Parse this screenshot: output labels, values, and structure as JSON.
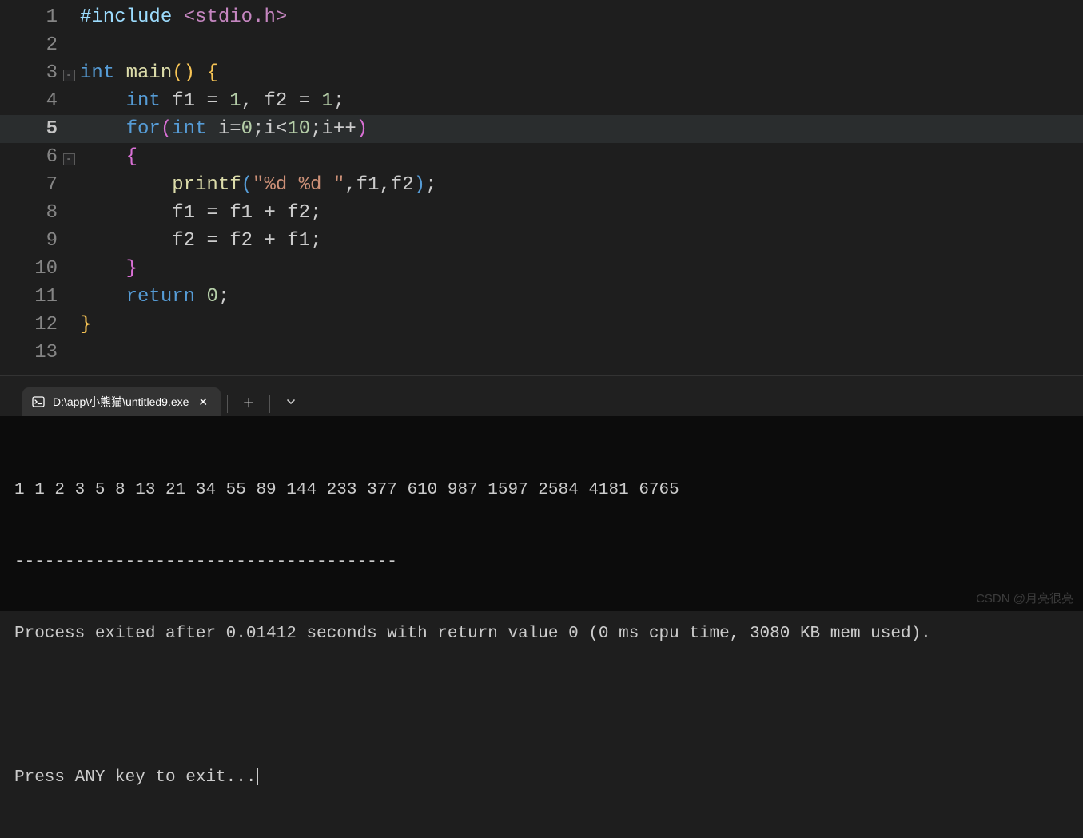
{
  "editor": {
    "highlighted_line": 5,
    "lines": [
      {
        "n": 1,
        "fold": "",
        "html": "<span class='pp'>#include</span> <span class='hdr'>&lt;stdio.h&gt;</span>"
      },
      {
        "n": 2,
        "fold": "line",
        "html": ""
      },
      {
        "n": 3,
        "fold": "box",
        "html": "<span class='kw'>int</span> <span class='fn'>main</span><span class='brace'>(</span><span class='brace'>)</span> <span class='brace'>{</span>"
      },
      {
        "n": 4,
        "fold": "line",
        "html": "    <span class='kw'>int</span> <span class='var'>f1</span> <span class='op'>=</span> <span class='num'>1</span><span class='punc'>,</span> <span class='var'>f2</span> <span class='op'>=</span> <span class='num'>1</span><span class='punc'>;</span>"
      },
      {
        "n": 5,
        "fold": "line",
        "html": "    <span class='kw'>for</span><span class='br2'>(</span><span class='kw'>int</span> <span class='var'>i</span><span class='op'>=</span><span class='num'>0</span><span class='punc'>;</span><span class='var'>i</span><span class='op'>&lt;</span><span class='num'>10</span><span class='punc'>;</span><span class='var'>i</span><span class='op'>++</span><span class='br2'>)</span>"
      },
      {
        "n": 6,
        "fold": "box",
        "html": "    <span class='br2'>{</span>"
      },
      {
        "n": 7,
        "fold": "line",
        "html": "        <span class='fn'>printf</span><span class='br3'>(</span><span class='str'>\"%d %d \"</span><span class='punc'>,</span><span class='var'>f1</span><span class='punc'>,</span><span class='var'>f2</span><span class='br3'>)</span><span class='punc'>;</span>"
      },
      {
        "n": 8,
        "fold": "line",
        "html": "        <span class='var'>f1</span> <span class='op'>=</span> <span class='var'>f1</span> <span class='op'>+</span> <span class='var'>f2</span><span class='punc'>;</span>"
      },
      {
        "n": 9,
        "fold": "line",
        "html": "        <span class='var'>f2</span> <span class='op'>=</span> <span class='var'>f2</span> <span class='op'>+</span> <span class='var'>f1</span><span class='punc'>;</span>"
      },
      {
        "n": 10,
        "fold": "line",
        "html": "    <span class='br2'>}</span>"
      },
      {
        "n": 11,
        "fold": "line",
        "html": "    <span class='kw'>return</span> <span class='num'>0</span><span class='punc'>;</span>"
      },
      {
        "n": 12,
        "fold": "line",
        "html": "<span class='brace'>}</span>"
      },
      {
        "n": 13,
        "fold": "",
        "html": ""
      }
    ]
  },
  "terminal": {
    "tab_title": "D:\\app\\小熊猫\\untitled9.exe",
    "output_line": "1 1 2 3 5 8 13 21 34 55 89 144 233 377 610 987 1597 2584 4181 6765",
    "separator": "--------------------------------------",
    "exit_message": "Process exited after 0.01412 seconds with return value 0 (0 ms cpu time, 3080 KB mem used).",
    "prompt": "Press ANY key to exit..."
  },
  "watermark": "CSDN @月亮很亮"
}
